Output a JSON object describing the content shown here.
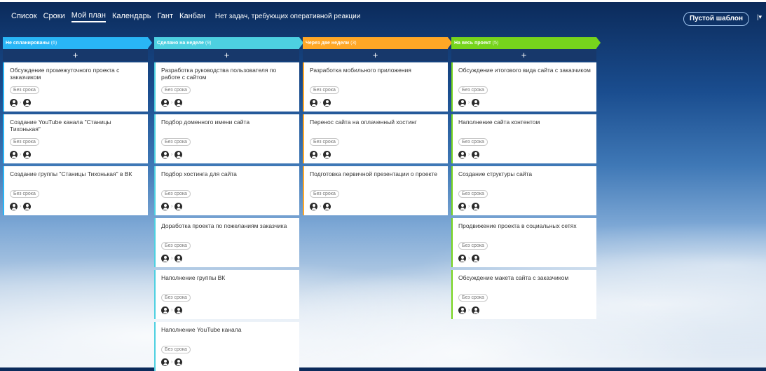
{
  "nav": {
    "items": [
      {
        "label": "Список",
        "active": false
      },
      {
        "label": "Сроки",
        "active": false
      },
      {
        "label": "Мой план",
        "active": true
      },
      {
        "label": "Календарь",
        "active": false
      },
      {
        "label": "Гант",
        "active": false
      },
      {
        "label": "Канбан",
        "active": false
      }
    ],
    "status": "Нет задач, требующих оперативной реакции",
    "template_button": "Пустой шаблон"
  },
  "add_label": "+",
  "columns": [
    {
      "title": "Не спланированы",
      "count": "(6)",
      "color": "#29b6f6",
      "cards": [
        {
          "title": "Обсуждение промежуточного проекта с заказчиком",
          "badge": "Без срока"
        },
        {
          "title": "Создание YouTube канала \"Станицы Тихонькая\"",
          "badge": "Без срока"
        },
        {
          "title": "Создание группы \"Станицы Тихонькая\" в ВК",
          "badge": "Без срока"
        }
      ]
    },
    {
      "title": "Сделано на неделе",
      "count": "(9)",
      "color": "#4dd0e1",
      "cards": [
        {
          "title": "Разработка руководства пользователя по работе с сайтом",
          "badge": "Без срока"
        },
        {
          "title": "Подбор доменного имени сайта",
          "badge": "Без срока"
        },
        {
          "title": "Подбор хостинга для сайта",
          "badge": "Без срока"
        },
        {
          "title": "Доработка проекта по пожеланиям заказчика",
          "badge": "Без срока"
        },
        {
          "title": "Наполнение группы ВК",
          "badge": "Без срока"
        },
        {
          "title": "Наполнение YouTube канала",
          "badge": "Без срока"
        }
      ]
    },
    {
      "title": "Через две недели",
      "count": "(3)",
      "color": "#ffa726",
      "cards": [
        {
          "title": "Разработка мобильного приложения",
          "badge": "Без срока"
        },
        {
          "title": "Перенос сайта на оплаченный хостинг",
          "badge": "Без срока"
        },
        {
          "title": "Подготовка первичной презентации о проекте",
          "badge": "Без срока"
        }
      ]
    },
    {
      "title": "На весь проект",
      "count": "(5)",
      "color": "#76d41c",
      "cards": [
        {
          "title": "Обсуждение итогового вида сайта с заказчиком",
          "badge": "Без срока"
        },
        {
          "title": "Наполнение сайта контентом",
          "badge": "Без срока"
        },
        {
          "title": "Создание структуры сайта",
          "badge": "Без срока"
        },
        {
          "title": "Продвижение проекта в социальных сетях",
          "badge": "Без срока"
        },
        {
          "title": "Обсуждение макета сайта с заказчиком",
          "badge": "Без срока"
        }
      ]
    }
  ]
}
